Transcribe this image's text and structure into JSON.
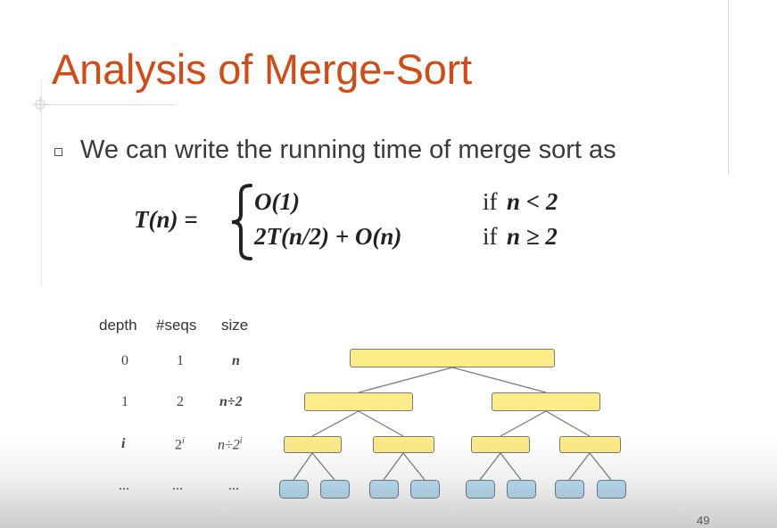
{
  "slide": {
    "title": "Analysis of Merge-Sort",
    "bullet": "We can write the running time of merge sort as",
    "page_number": "49"
  },
  "recurrence": {
    "lhs": "T(n) =",
    "case1_value": "O(1)",
    "case1_if": "if",
    "case1_cond": "n < 2",
    "case2_value": "2T(n/2) + O(n)",
    "case2_if": "if",
    "case2_cond": "n ≥ 2"
  },
  "table": {
    "headers": [
      "depth",
      "#seqs",
      "size"
    ],
    "rows": [
      [
        "0",
        "1",
        "n"
      ],
      [
        "1",
        "2",
        "n÷2"
      ],
      [
        "i",
        "2",
        "n÷2"
      ],
      [
        "...",
        "...",
        "..."
      ]
    ],
    "superscript": "i"
  },
  "tree": {
    "node_color": "#fbec88",
    "leaf_color": "#bde1f3",
    "levels": [
      1,
      2,
      4,
      8
    ]
  },
  "colors": {
    "title": "#d24a14",
    "text": "#3a3a3a"
  }
}
